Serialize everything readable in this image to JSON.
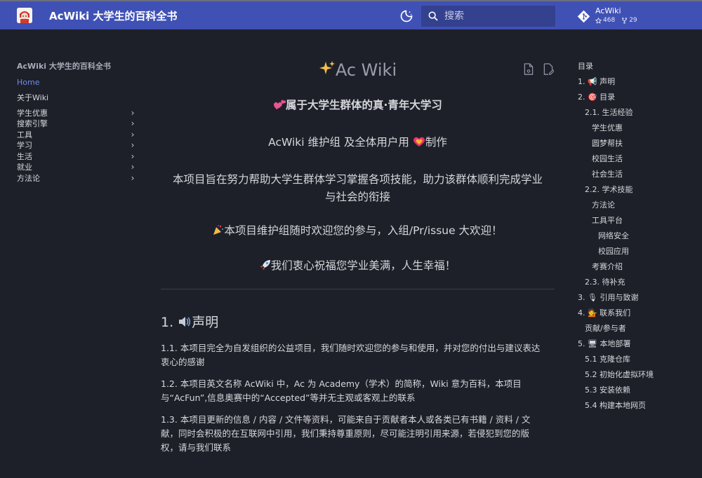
{
  "header": {
    "site_title": "AcWiki 大学生的百科全书",
    "search_placeholder": "搜索",
    "repo": {
      "name": "AcWiki",
      "stars": "468",
      "forks": "29"
    },
    "colors": {
      "primary": "#4051b5",
      "search_bg": "#34418f",
      "accent": "#6d8bea",
      "page_bg": "#1e2029"
    }
  },
  "sidebar": {
    "title": "AcWiki 大学生的百科全书",
    "items": [
      {
        "label": "Home"
      },
      {
        "label": "关于Wiki"
      },
      {
        "label": "学生优惠"
      },
      {
        "label": "搜索引擎"
      },
      {
        "label": "工具"
      },
      {
        "label": "学习"
      },
      {
        "label": "生活"
      },
      {
        "label": "就业"
      },
      {
        "label": "方法论"
      }
    ]
  },
  "main": {
    "title": "Ac Wiki",
    "title_icon": "sparkles-icon",
    "lines": [
      "属于大学生群体的真·青年大学习",
      "AcWiki 维护组 及全体用户用",
      "制作",
      "本项目旨在努力帮助大学生群体学习掌握各项技能，助力该群体顺利完成学业",
      "与社会的衔接",
      "本项目维护组随时欢迎您的参与，入组/Pr/issue 大欢迎！",
      "我们衷心祝福您学业美满，人生幸福！"
    ],
    "section": {
      "heading_num": "1.",
      "heading": "声明",
      "paragraphs": [
        [
          "1.1. 本项目完全为自发组织的公益项目，我们随时欢迎您的参与和使用，并对您的付出与建议表达",
          "衷心的感谢"
        ],
        [
          "1.2. 本项目英文名称 AcWiki 中，Ac 为 Academy（学术）的简称，Wiki 意为百科，本项目",
          "与“AcFun”,信息奥赛中的“Accepted”等并无主观或客观上的联系"
        ],
        [
          "1.3. 本项目更新的信息 / 内容 / 文件等资料，可能来自于贡献者本人或各类已有书籍 / 资料 / 文",
          "献，同时会积极的在互联网中引用，我们秉持尊重原则，尽可能注明引用来源，若侵犯到您的版",
          "权，请与我们联系"
        ]
      ]
    }
  },
  "toc": {
    "title": "目录",
    "items": [
      {
        "label": "1. 📢 声明"
      },
      {
        "label": "2. 🎯 目录"
      },
      {
        "label": "2.1. 生活经验"
      },
      {
        "label": "学生优惠"
      },
      {
        "label": "圆梦帮扶"
      },
      {
        "label": "校园生活"
      },
      {
        "label": "社会生活"
      },
      {
        "label": "2.2. 学术技能"
      },
      {
        "label": "方法论"
      },
      {
        "label": "工具平台"
      },
      {
        "label": "网络安全"
      },
      {
        "label": "校园应用"
      },
      {
        "label": "考赛介绍"
      },
      {
        "label": "2.3. 待补充"
      },
      {
        "label": "3. 🎙 引用与致谢"
      },
      {
        "label": "4. 💁 联系我们"
      },
      {
        "label": "贡献/参与者"
      },
      {
        "label": "5. 🖥 本地部署"
      },
      {
        "label": "5.1 克隆仓库"
      },
      {
        "label": "5.2 初始化虚拟环境"
      },
      {
        "label": "5.3 安装依赖"
      },
      {
        "label": "5.4 构建本地网页"
      }
    ]
  }
}
